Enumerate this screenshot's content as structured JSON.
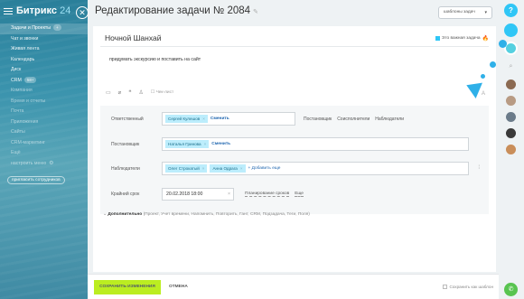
{
  "sidebar": {
    "logo_main": "Битрикс",
    "logo_num": "24",
    "items": [
      {
        "label": "Задачи и Проекты",
        "count": "+",
        "active": true
      },
      {
        "label": "Чат и звонки"
      },
      {
        "label": "Живая лента"
      },
      {
        "label": "Календарь"
      },
      {
        "label": "Диск"
      },
      {
        "label": "CRM",
        "count": "58+"
      },
      {
        "label": "Компания"
      },
      {
        "label": "Время и отчеты"
      },
      {
        "label": "Почта"
      },
      {
        "label": "Приложения"
      },
      {
        "label": "Сайты"
      },
      {
        "label": "CRM-маркетинг"
      },
      {
        "label": "Ещё"
      },
      {
        "label": "настроить меню"
      }
    ],
    "invite_label": "пригласить сотрудников"
  },
  "header": {
    "title": "Редактирование задачи № 2084",
    "templates_button": "шаблоны задач"
  },
  "task": {
    "name": "Ночной Шанхай",
    "important_label": "Это важная задача",
    "description": "придумать экскурсию и поставить на сайт",
    "checklist_label": "Чек-лист"
  },
  "fields": {
    "responsible": {
      "label": "Ответственный",
      "tags": [
        "Сергей Кулешов"
      ],
      "change_link": "Сменить",
      "side_links": [
        "Постановщик",
        "Соисполнители",
        "Наблюдатели"
      ]
    },
    "creator": {
      "label": "Постановщик",
      "tags": [
        "Наталья Гринова"
      ],
      "change_link": "Сменить"
    },
    "observers": {
      "label": "Наблюдатели",
      "tags": [
        "Олег Строкатый",
        "Анна Одрага"
      ],
      "add_link": "+ Добавить еще"
    },
    "deadline": {
      "label": "Крайний срок",
      "value": "20.02.2018 18:00",
      "links": [
        "Планирование сроков",
        "Еще"
      ]
    }
  },
  "more": {
    "label": "Дополнительно",
    "items": "(Проект, Учет времени, Напомнить, Повторить, Гант, CRM, Подзадача, Теги, Поля)"
  },
  "footer": {
    "save_label": "СОХРАНИТЬ ИЗМЕНЕНИЯ",
    "cancel_label": "ОТМЕНА",
    "save_template_label": "Сохранить как шаблон"
  },
  "colors": {
    "accent": "#2fc6f6",
    "save": "#bbed21",
    "tag": "#bcedfc"
  }
}
